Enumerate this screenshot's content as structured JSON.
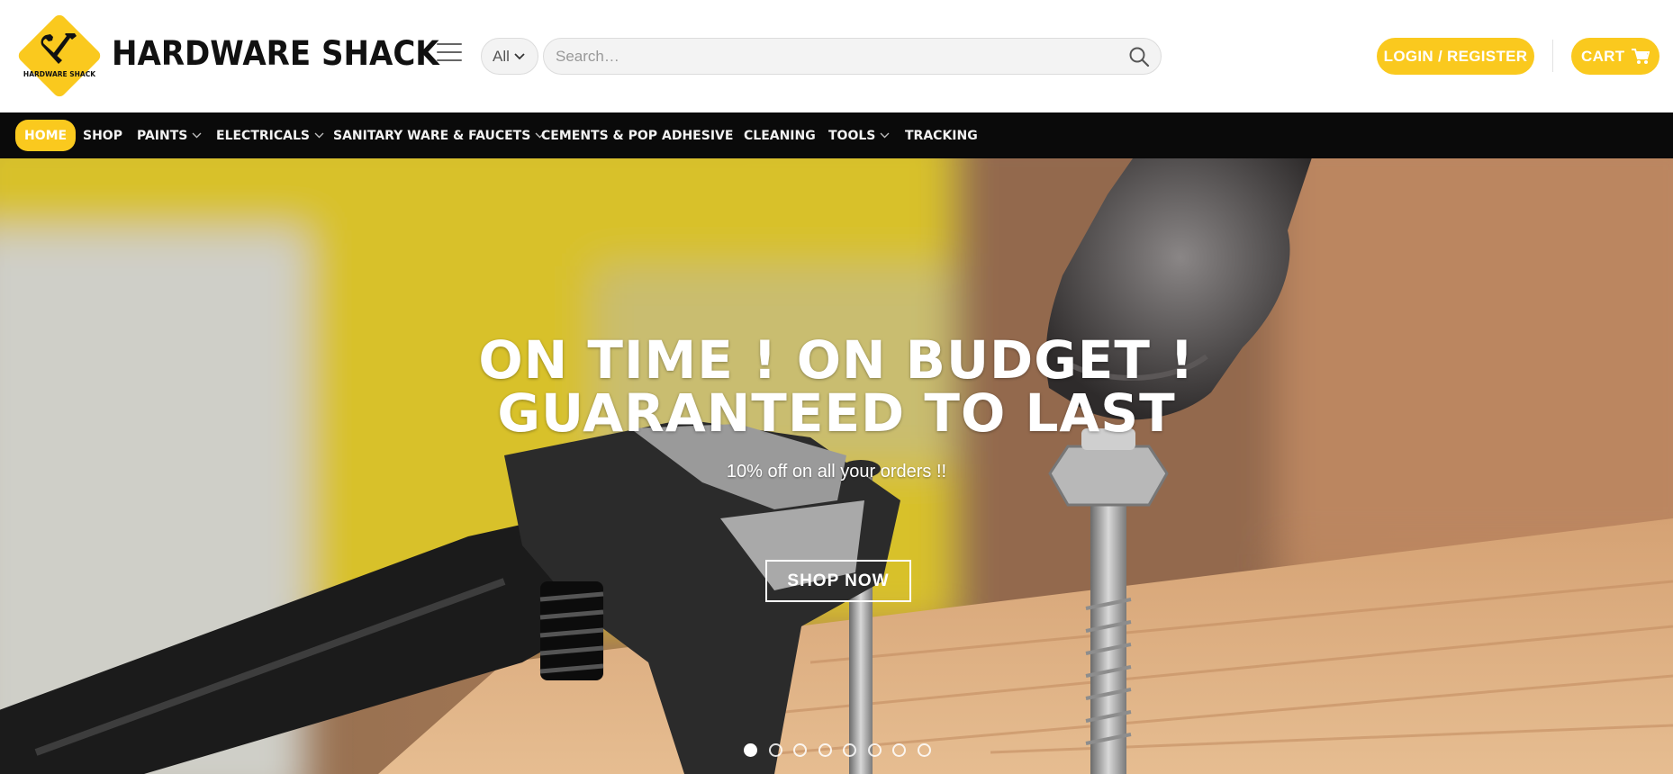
{
  "header": {
    "logo_text": "HARDWARE SHACK",
    "brand": "HARDWARE SHACK",
    "category_select": "All",
    "search_placeholder": "Search…",
    "login_label": "LOGIN / REGISTER",
    "cart_label": "CART"
  },
  "nav": {
    "items": [
      {
        "label": "HOME",
        "active": true,
        "dropdown": false
      },
      {
        "label": "SHOP",
        "dropdown": false
      },
      {
        "label": "PAINTS",
        "dropdown": true
      },
      {
        "label": "ELECTRICALS",
        "dropdown": true
      },
      {
        "label": "SANITARY WARE & FAUCETS",
        "dropdown": true
      },
      {
        "label": "CEMENTS & POP",
        "dropdown": false
      },
      {
        "label": "ADHESIVE",
        "dropdown": false
      },
      {
        "label": "CLEANING",
        "dropdown": false
      },
      {
        "label": "TOOLS",
        "dropdown": true
      },
      {
        "label": "TRACKING",
        "dropdown": false
      }
    ]
  },
  "hero": {
    "title_line1": "ON TIME ! ON BUDGET !",
    "title_line2": "GUARANTEED TO LAST",
    "subtitle": "10% off on all your orders !!",
    "cta_label": "SHOP NOW",
    "slide_count": 8,
    "active_slide": 1
  },
  "colors": {
    "accent": "#fac91e",
    "nav_bg": "#0a0a0a",
    "text_dark": "#111111"
  },
  "icons": [
    "tools-logo-icon",
    "hamburger-menu-icon",
    "chevron-down-icon",
    "search-icon",
    "cart-icon"
  ]
}
